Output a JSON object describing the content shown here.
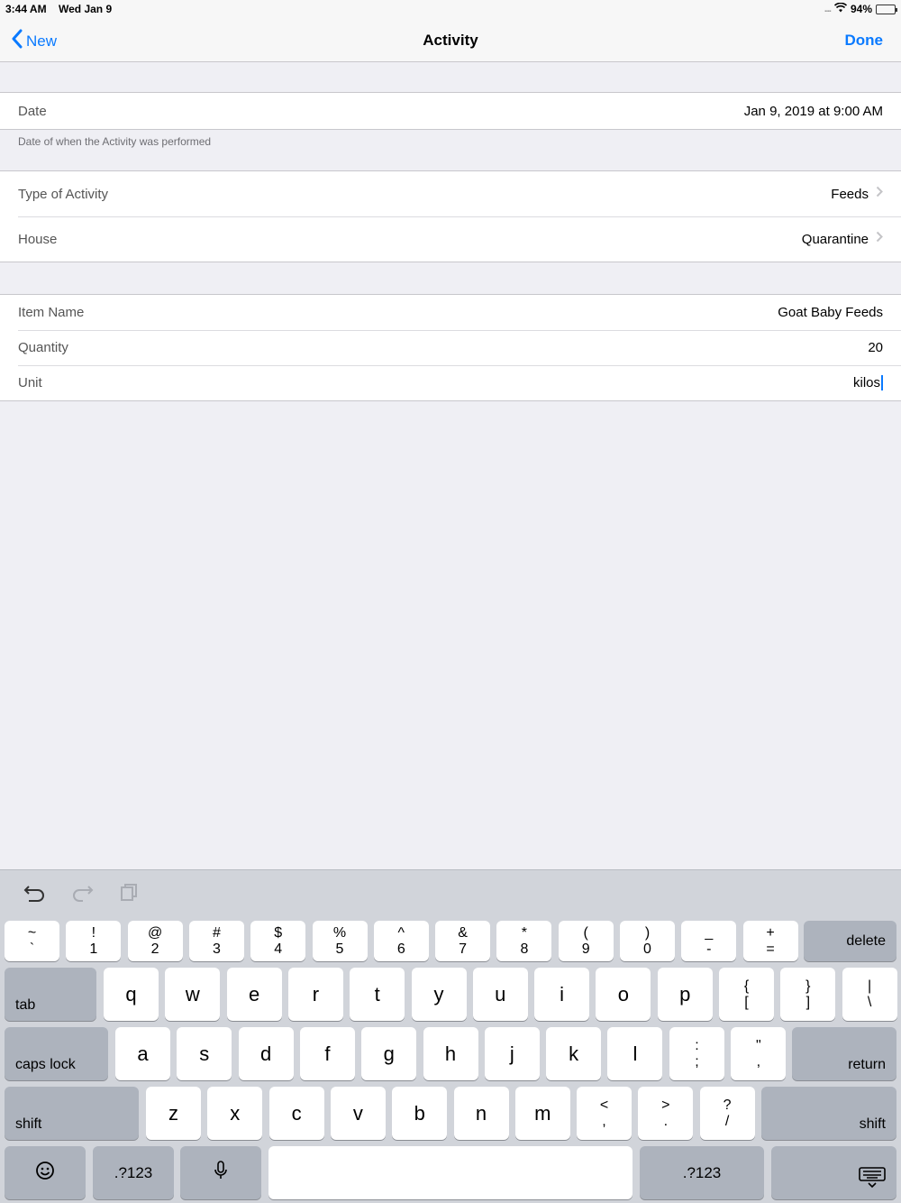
{
  "status_bar": {
    "time": "3:44 AM",
    "date": "Wed Jan 9",
    "dots": "....",
    "battery": "94%",
    "battery_level": 0.94
  },
  "nav": {
    "back_label": "New",
    "title": "Activity",
    "done_label": "Done"
  },
  "section1": {
    "date_label": "Date",
    "date_value": "Jan 9, 2019 at 9:00 AM",
    "date_footnote": "Date of when the Activity was performed"
  },
  "section2": {
    "type_label": "Type of Activity",
    "type_value": "Feeds",
    "house_label": "House",
    "house_value": "Quarantine"
  },
  "section3": {
    "item_label": "Item Name",
    "item_value": "Goat Baby Feeds",
    "quantity_label": "Quantity",
    "quantity_value": "20",
    "unit_label": "Unit",
    "unit_value": "kilos"
  },
  "keyboard": {
    "row1": [
      {
        "top": "~",
        "bottom": "`"
      },
      {
        "top": "!",
        "bottom": "1"
      },
      {
        "top": "@",
        "bottom": "2"
      },
      {
        "top": "#",
        "bottom": "3"
      },
      {
        "top": "$",
        "bottom": "4"
      },
      {
        "top": "%",
        "bottom": "5"
      },
      {
        "top": "^",
        "bottom": "6"
      },
      {
        "top": "&",
        "bottom": "7"
      },
      {
        "top": "*",
        "bottom": "8"
      },
      {
        "top": "(",
        "bottom": "9"
      },
      {
        "top": ")",
        "bottom": "0"
      },
      {
        "top": "_",
        "bottom": "-"
      },
      {
        "top": "+",
        "bottom": "="
      }
    ],
    "delete": "delete",
    "tab": "tab",
    "row2": [
      "q",
      "w",
      "e",
      "r",
      "t",
      "y",
      "u",
      "i",
      "o",
      "p"
    ],
    "row2_dual": [
      {
        "top": "{",
        "bottom": "["
      },
      {
        "top": "}",
        "bottom": "]"
      },
      {
        "top": "|",
        "bottom": "\\"
      }
    ],
    "caps_lock": "caps lock",
    "row3": [
      "a",
      "s",
      "d",
      "f",
      "g",
      "h",
      "j",
      "k",
      "l"
    ],
    "row3_dual": [
      {
        "top": ":",
        "bottom": ";"
      },
      {
        "top": "\"",
        "bottom": ","
      }
    ],
    "return": "return",
    "shift": "shift",
    "row4": [
      "z",
      "x",
      "c",
      "v",
      "b",
      "n",
      "m"
    ],
    "row4_dual": [
      {
        "top": "<",
        "bottom": ","
      },
      {
        "top": ">",
        "bottom": "."
      },
      {
        "top": "?",
        "bottom": "/"
      }
    ],
    "numbers_label": ".?123"
  }
}
